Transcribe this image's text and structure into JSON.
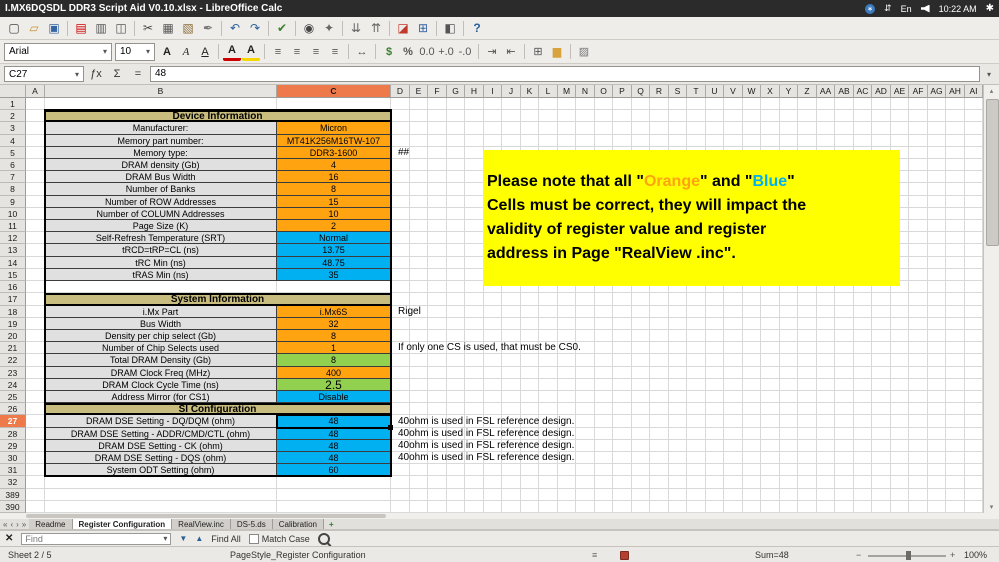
{
  "window": {
    "title": "I.MX6DQSDL DDR3 Script Aid V0.10.xlsx - LibreOffice Calc",
    "tray": {
      "keyboard_layout": "En",
      "clock": "10:22 AM"
    }
  },
  "standard_toolbar": {
    "icons": [
      "new-document",
      "open",
      "save",
      "|",
      "export-pdf",
      "print",
      "print-preview",
      "|",
      "cut",
      "copy",
      "paste",
      "clone-formatting",
      "|",
      "undo",
      "redo",
      "|",
      "spelling",
      "|",
      "find-replace",
      "navigator",
      "|",
      "sort-ascending",
      "sort-descending",
      "|",
      "insert-chart",
      "insert-table",
      "|",
      "freeze-panes",
      "|",
      "help"
    ]
  },
  "formatting_toolbar": {
    "font_name": "Arial",
    "font_size": "10",
    "icons": [
      "bold",
      "italic",
      "underline",
      "|",
      "font-color",
      "highlight-color",
      "|",
      "align-left",
      "align-center",
      "align-right",
      "justify",
      "|",
      "merge-cells",
      "|",
      "format-currency",
      "format-percent",
      "format-number",
      "decimal-add",
      "decimal-remove",
      "|",
      "indent-increase",
      "indent-decrease",
      "|",
      "borders",
      "background-color",
      "|",
      "conditional-formatting"
    ]
  },
  "formula_bar": {
    "cell_ref": "C27",
    "content": "48"
  },
  "grid": {
    "columns": [
      "A",
      "B",
      "C",
      "D",
      "E",
      "F",
      "G",
      "H",
      "I",
      "J",
      "K",
      "L",
      "M",
      "N",
      "O",
      "P",
      "Q",
      "R",
      "S",
      "T",
      "U",
      "V",
      "W",
      "X",
      "Y",
      "Z",
      "AA",
      "AB",
      "AC",
      "AD",
      "AE",
      "AF",
      "AG",
      "AH",
      "AI"
    ],
    "rows": [
      "1",
      "2",
      "3",
      "4",
      "5",
      "6",
      "7",
      "8",
      "9",
      "10",
      "11",
      "12",
      "13",
      "14",
      "15",
      "16",
      "17",
      "18",
      "19",
      "20",
      "21",
      "22",
      "23",
      "24",
      "25",
      "26",
      "27",
      "28",
      "29",
      "30",
      "31",
      "32",
      "389",
      "390"
    ],
    "selected_column": "C",
    "selected_row": "27"
  },
  "sheet": {
    "sections": [
      {
        "row": 2,
        "title": "Device Information",
        "items": [
          {
            "row": 3,
            "label": "Manufacturer:",
            "value": "Micron",
            "color": "orange"
          },
          {
            "row": 4,
            "label": "Memory part number:",
            "value": "MT41K256M16TW-107",
            "color": "orange"
          },
          {
            "row": 5,
            "label": "Memory type:",
            "value": "DDR3-1600",
            "color": "orange",
            "note": "##"
          },
          {
            "row": 6,
            "label": "DRAM density (Gb)",
            "value": "4",
            "color": "orange"
          },
          {
            "row": 7,
            "label": "DRAM Bus Width",
            "value": "16",
            "color": "orange"
          },
          {
            "row": 8,
            "label": "Number of Banks",
            "value": "8",
            "color": "orange"
          },
          {
            "row": 9,
            "label": "Number of ROW Addresses",
            "value": "15",
            "color": "orange"
          },
          {
            "row": 10,
            "label": "Number of COLUMN Addresses",
            "value": "10",
            "color": "orange"
          },
          {
            "row": 11,
            "label": "Page Size (K)",
            "value": "2",
            "color": "orange"
          },
          {
            "row": 12,
            "label": "Self-Refresh Temperature (SRT)",
            "value": "Normal",
            "color": "blue"
          },
          {
            "row": 13,
            "label": "tRCD=tRP=CL (ns)",
            "value": "13.75",
            "color": "blue"
          },
          {
            "row": 14,
            "label": "tRC Min (ns)",
            "value": "48.75",
            "color": "blue"
          },
          {
            "row": 15,
            "label": "tRAS Min (ns)",
            "value": "35",
            "color": "blue"
          }
        ]
      },
      {
        "row": 17,
        "title": "System Information",
        "items": [
          {
            "row": 18,
            "label": "i.Mx Part",
            "value": "i.Mx6S",
            "color": "orange",
            "note": "Rigel"
          },
          {
            "row": 19,
            "label": "Bus Width",
            "value": "32",
            "color": "orange"
          },
          {
            "row": 20,
            "label": "Density per chip select (Gb)",
            "value": "8",
            "color": "orange"
          },
          {
            "row": 21,
            "label": "Number of Chip Selects used",
            "value": "1",
            "color": "orange",
            "note": "If only one CS is used, that must be CS0."
          },
          {
            "row": 22,
            "label": "Total DRAM Density (Gb)",
            "value": "8",
            "color": "green"
          },
          {
            "row": 23,
            "label": "DRAM Clock Freq (MHz)",
            "value": "400",
            "color": "orange"
          },
          {
            "row": 24,
            "label": "DRAM Clock Cycle Time (ns)",
            "value": "2.5",
            "color": "green",
            "big": true
          },
          {
            "row": 25,
            "label": "Address Mirror (for CS1)",
            "value": "Disable",
            "color": "blue"
          }
        ]
      },
      {
        "row": 26,
        "title": "SI Configuration",
        "items": [
          {
            "row": 27,
            "label": "DRAM DSE Setting - DQ/DQM (ohm)",
            "value": "48",
            "color": "blue",
            "note": "40ohm is used in FSL reference design.",
            "selected": true
          },
          {
            "row": 28,
            "label": "DRAM DSE Setting - ADDR/CMD/CTL (ohm)",
            "value": "48",
            "color": "blue",
            "note": "40ohm is used in FSL reference design."
          },
          {
            "row": 29,
            "label": "DRAM DSE Setting - CK (ohm)",
            "value": "48",
            "color": "blue",
            "note": "40ohm is used in FSL reference design."
          },
          {
            "row": 30,
            "label": "DRAM DSE Setting - DQS (ohm)",
            "value": "48",
            "color": "blue",
            "note": "40ohm is used in FSL reference design."
          },
          {
            "row": 31,
            "label": "System ODT Setting (ohm)",
            "value": "60",
            "color": "blue"
          }
        ]
      }
    ]
  },
  "note_box": {
    "parts": [
      {
        "text": "Please note that all \""
      },
      {
        "text": "Orange",
        "color": "orange"
      },
      {
        "text": "\" and \""
      },
      {
        "text": "Blue",
        "color": "blue"
      },
      {
        "text": "\"\nCells must be correct, they will impact the\nvalidity of register value and register\naddress in Page \"RealView .inc\"."
      }
    ]
  },
  "sheet_tabs": {
    "items": [
      {
        "label": "Readme"
      },
      {
        "label": "Register Configuration",
        "active": true
      },
      {
        "label": "RealView.inc"
      },
      {
        "label": "DS-5.ds"
      },
      {
        "label": "Calibration"
      }
    ]
  },
  "find_bar": {
    "query": "Find",
    "find_all_label": "Find All",
    "match_case_label": "Match Case"
  },
  "status_bar": {
    "sheet_info": "Sheet 2 / 5",
    "page_style": "PageStyle_Register Configuration",
    "sum": "Sum=48",
    "zoom_percent": "100%"
  },
  "colors": {
    "orange": "#FFA410",
    "blue": "#00B0F0",
    "green": "#92D050",
    "section_header": "#C8BC7E",
    "label_bg": "#E0E0E0",
    "note_bg": "#FFFF00",
    "selected_header": "#EE7A4B"
  }
}
